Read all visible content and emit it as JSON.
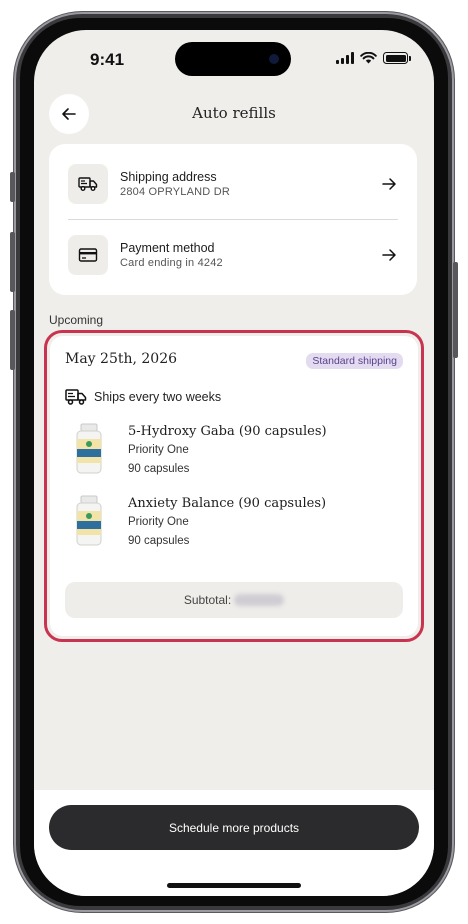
{
  "status_bar": {
    "time": "9:41"
  },
  "header": {
    "title": "Auto refills",
    "back_icon": "arrow-left-icon"
  },
  "settings": {
    "shipping": {
      "title": "Shipping address",
      "value": "2804 OPRYLAND DR",
      "icon": "truck-icon"
    },
    "payment": {
      "title": "Payment method",
      "value": "Card ending in 4242",
      "icon": "credit-card-icon"
    }
  },
  "upcoming": {
    "section_label": "Upcoming",
    "date": "May 25th, 2026",
    "badge": "Standard shipping",
    "frequency": "Ships every two weeks",
    "products": [
      {
        "name": "5-Hydroxy Gaba (90 capsules)",
        "brand": "Priority One",
        "qty": "90 capsules"
      },
      {
        "name": "Anxiety Balance (90 capsules)",
        "brand": "Priority One",
        "qty": "90 capsules"
      }
    ],
    "subtotal_label": "Subtotal:"
  },
  "cta": {
    "label": "Schedule more products"
  },
  "colors": {
    "highlight": "#c8344f",
    "badge_bg": "#e3dcf0",
    "badge_text": "#5b3f8c",
    "cta_bg": "#2b2b2d"
  }
}
